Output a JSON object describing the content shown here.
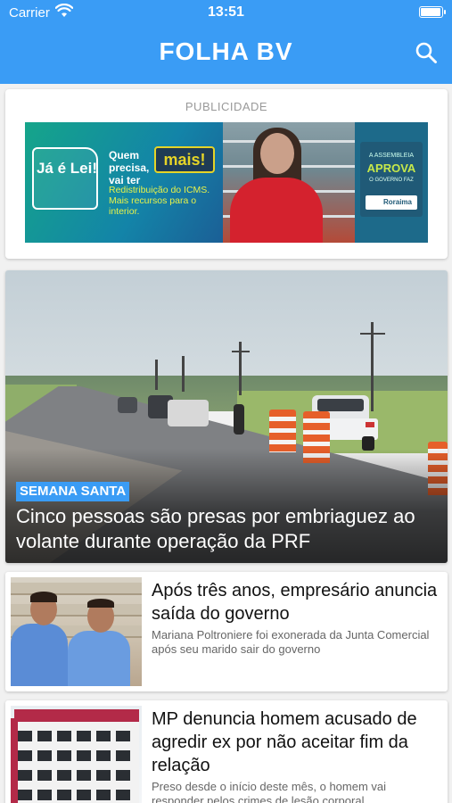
{
  "status_bar": {
    "carrier": "Carrier",
    "time": "13:51",
    "battery_level": 0.95
  },
  "header": {
    "title": "FOLHA BV",
    "search_icon": "search-icon"
  },
  "ad": {
    "label": "PUBLICIDADE",
    "banner": {
      "badge": "Já é Lei!",
      "headline": "Quem precisa, vai ter",
      "highlight": "mais!",
      "subtext": "Redistribuição do ICMS. Mais recursos para o interior.",
      "seal_top": "A ASSEMBLEIA",
      "seal_main": "APROVA",
      "seal_sub": "O GOVERNO FAZ",
      "logo": "Roraima"
    }
  },
  "hero": {
    "tag": "SEMANA SANTA",
    "title": "Cinco pessoas são presas por embriaguez ao volante durante operação da PRF"
  },
  "articles": [
    {
      "title": "Após três anos, empresário anuncia saída do governo",
      "summary": "Mariana Poltroniere foi exonerada da Junta Comercial após seu marido sair do governo"
    },
    {
      "title": "MP denuncia homem acusado de agredir ex por não aceitar fim da relação",
      "summary": "Preso desde o início deste mês, o homem vai responder pelos crimes de lesão corporal"
    }
  ],
  "colors": {
    "header": "#3a9cf5",
    "tag": "#3a9cf5",
    "background": "#f1f1f1"
  }
}
